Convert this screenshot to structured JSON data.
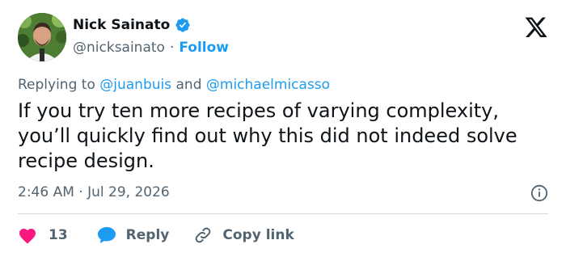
{
  "author": {
    "name": "Nick Sainato",
    "handle": "@nicksainato",
    "separator": "·",
    "follow_label": "Follow"
  },
  "reply_context": {
    "prefix": "Replying to",
    "mention_1": "@juanbuis",
    "conjunction": "and",
    "mention_2": "@michaelmicasso"
  },
  "tweet": {
    "text": "If you try ten more recipes of varying complexity, you’ll quickly find out why this did not indeed solve recipe design.",
    "timestamp": "2:46 AM · Jul 29, 2026"
  },
  "actions": {
    "like_count": "13",
    "reply_label": "Reply",
    "copy_label": "Copy link"
  },
  "icons": {
    "verified": "verified-badge-icon",
    "platform": "x-logo-icon",
    "info": "info-icon",
    "like": "heart-icon",
    "reply": "speech-bubble-icon",
    "copy": "link-icon"
  },
  "colors": {
    "accent": "#1d9bf0",
    "like": "#f91880",
    "secondary_text": "#536471",
    "primary_text": "#0f1419"
  }
}
